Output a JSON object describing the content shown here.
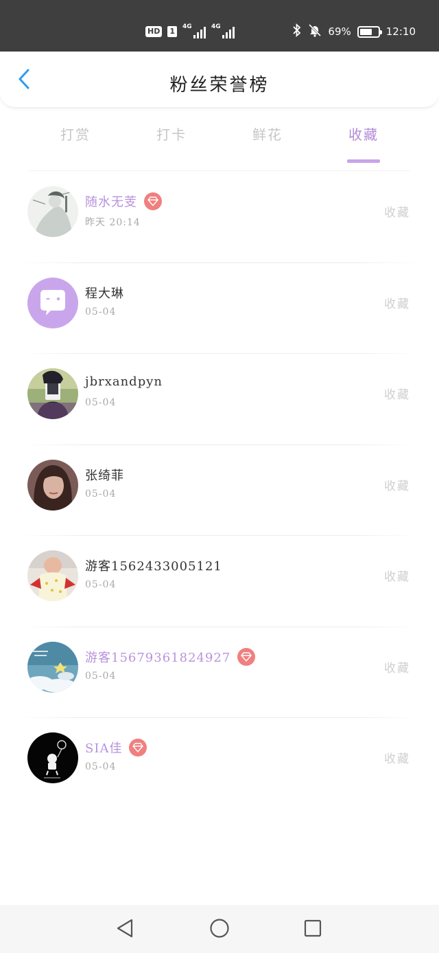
{
  "status_bar": {
    "hd": "HD",
    "sim": "1",
    "network1": "4G",
    "network2": "4G",
    "battery_percent": "69%",
    "battery_level": 0.69,
    "time": "12:10",
    "icons": [
      "bluetooth-icon",
      "mute-bell-icon",
      "battery-icon"
    ]
  },
  "header": {
    "title": "粉丝荣誉榜",
    "back_icon": "back-chevron-icon",
    "accent_color": "#2d9cf0"
  },
  "tabs": [
    {
      "label": "打赏",
      "active": false
    },
    {
      "label": "打卡",
      "active": false
    },
    {
      "label": "鲜花",
      "active": false
    },
    {
      "label": "收藏",
      "active": true
    }
  ],
  "theme": {
    "active_tab_color": "#b28ad9",
    "vip_name_color": "#b892dc",
    "badge_color": "#f07f7f"
  },
  "fans": [
    {
      "name": "随水无芰",
      "time": "昨天 20:14",
      "action": "收藏",
      "vip": true,
      "avatar": "ink-painting-avatar"
    },
    {
      "name": "程大琳",
      "time": "05-04",
      "action": "收藏",
      "vip": false,
      "avatar": "default-chat-avatar"
    },
    {
      "name": "jbrxandpyn",
      "time": "05-04",
      "action": "收藏",
      "vip": false,
      "avatar": "photo-avatar"
    },
    {
      "name": "张绮菲",
      "time": "05-04",
      "action": "收藏",
      "vip": false,
      "avatar": "portrait-avatar"
    },
    {
      "name": "游客1562433005121",
      "time": "05-04",
      "action": "收藏",
      "vip": false,
      "avatar": "baby-avatar"
    },
    {
      "name": "游客15679361824927",
      "time": "05-04",
      "action": "收藏",
      "vip": true,
      "avatar": "sky-avatar"
    },
    {
      "name": "SIA佳",
      "time": "05-04",
      "action": "收藏",
      "vip": true,
      "avatar": "astronaut-avatar"
    }
  ],
  "nav_bar": {
    "buttons": [
      "back-triangle-icon",
      "home-circle-icon",
      "recents-square-icon"
    ]
  }
}
